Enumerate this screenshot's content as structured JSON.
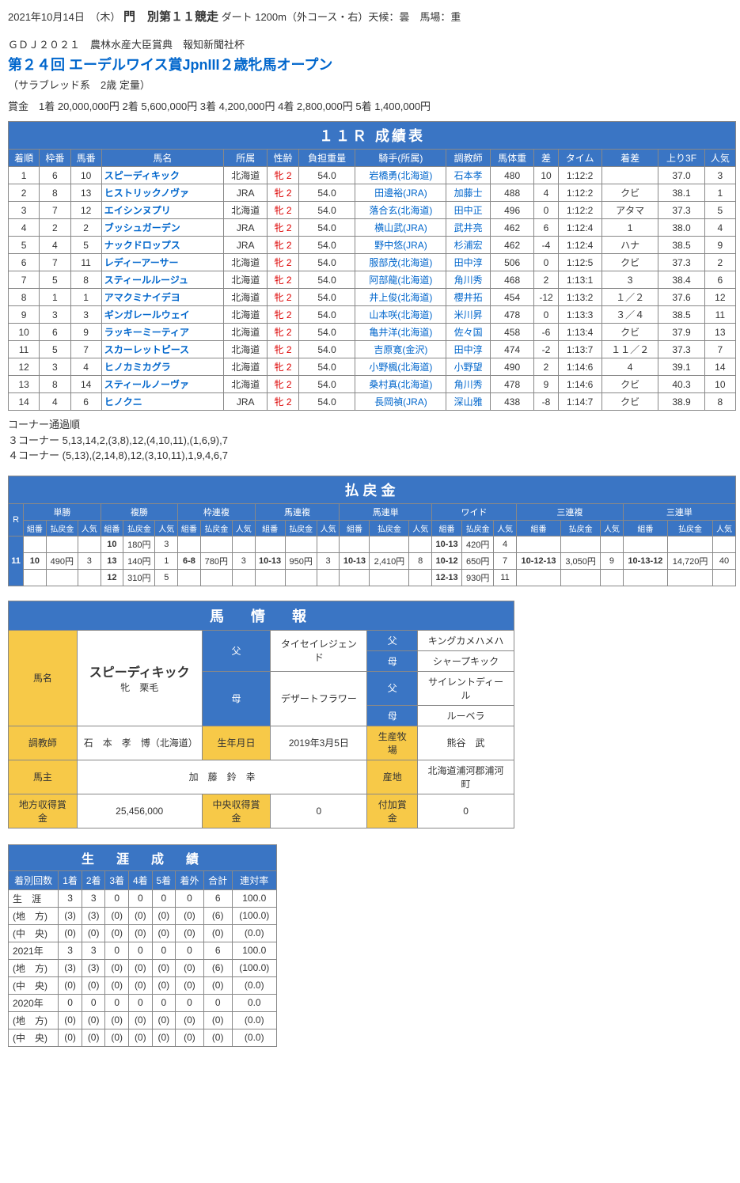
{
  "header": {
    "date": "2021年10月14日　（木）",
    "track": "門　別第１１競走",
    "course": "ダート 1200m（外コース・右）天候：曇　馬場：重",
    "gd": "ＧＤＪ２０２１　農林水産大臣賞典　報知新聞社杯",
    "title": "第２４回 エーデルワイス賞JpnIII２歳牝馬オープン",
    "sub": "（サラブレッド系　2歳 定量）",
    "prize": "賞金　1着 20,000,000円  2着 5,600,000円  3着 4,200,000円  4着 2,800,000円  5着 1,400,000円"
  },
  "result": {
    "title": "１１Ｒ 成績表",
    "cols": [
      "着順",
      "枠番",
      "馬番",
      "馬名",
      "所属",
      "性齢",
      "負担重量",
      "騎手(所属)",
      "調教師",
      "馬体重",
      "差",
      "タイム",
      "着差",
      "上り3F",
      "人気"
    ],
    "rows": [
      [
        "1",
        "6",
        "10",
        "スピーディキック",
        "北海道",
        "牝 2",
        "54.0",
        "岩橋勇(北海道)",
        "石本孝",
        "480",
        "10",
        "1:12:2",
        "",
        "37.0",
        "3"
      ],
      [
        "2",
        "8",
        "13",
        "ヒストリックノヴァ",
        "JRA",
        "牝 2",
        "54.0",
        "田邊裕(JRA)",
        "加藤士",
        "488",
        "4",
        "1:12:2",
        "クビ",
        "38.1",
        "1"
      ],
      [
        "3",
        "7",
        "12",
        "エイシンヌプリ",
        "北海道",
        "牝 2",
        "54.0",
        "落合玄(北海道)",
        "田中正",
        "496",
        "0",
        "1:12:2",
        "アタマ",
        "37.3",
        "5"
      ],
      [
        "4",
        "2",
        "2",
        "ブッシュガーデン",
        "JRA",
        "牝 2",
        "54.0",
        "横山武(JRA)",
        "武井亮",
        "462",
        "6",
        "1:12:4",
        "1",
        "38.0",
        "4"
      ],
      [
        "5",
        "4",
        "5",
        "ナックドロップス",
        "JRA",
        "牝 2",
        "54.0",
        "野中悠(JRA)",
        "杉浦宏",
        "462",
        "-4",
        "1:12:4",
        "ハナ",
        "38.5",
        "9"
      ],
      [
        "6",
        "7",
        "11",
        "レディーアーサー",
        "北海道",
        "牝 2",
        "54.0",
        "服部茂(北海道)",
        "田中淳",
        "506",
        "0",
        "1:12:5",
        "クビ",
        "37.3",
        "2"
      ],
      [
        "7",
        "5",
        "8",
        "スティールルージュ",
        "北海道",
        "牝 2",
        "54.0",
        "阿部龍(北海道)",
        "角川秀",
        "468",
        "2",
        "1:13:1",
        "3",
        "38.4",
        "6"
      ],
      [
        "8",
        "1",
        "1",
        "アマクミナイデヨ",
        "北海道",
        "牝 2",
        "54.0",
        "井上俊(北海道)",
        "櫻井拓",
        "454",
        "-12",
        "1:13:2",
        "１／２",
        "37.6",
        "12"
      ],
      [
        "9",
        "3",
        "3",
        "ギンガレールウェイ",
        "北海道",
        "牝 2",
        "54.0",
        "山本咲(北海道)",
        "米川昇",
        "478",
        "0",
        "1:13:3",
        "３／４",
        "38.5",
        "11"
      ],
      [
        "10",
        "6",
        "9",
        "ラッキーミーティア",
        "北海道",
        "牝 2",
        "54.0",
        "亀井洋(北海道)",
        "佐々国",
        "458",
        "-6",
        "1:13:4",
        "クビ",
        "37.9",
        "13"
      ],
      [
        "11",
        "5",
        "7",
        "スカーレットピース",
        "北海道",
        "牝 2",
        "54.0",
        "吉原寛(金沢)",
        "田中淳",
        "474",
        "-2",
        "1:13:7",
        "１１／２",
        "37.3",
        "7"
      ],
      [
        "12",
        "3",
        "4",
        "ヒノカミカグラ",
        "北海道",
        "牝 2",
        "54.0",
        "小野楓(北海道)",
        "小野望",
        "490",
        "2",
        "1:14:6",
        "4",
        "39.1",
        "14"
      ],
      [
        "13",
        "8",
        "14",
        "スティールノーヴァ",
        "北海道",
        "牝 2",
        "54.0",
        "桑村真(北海道)",
        "角川秀",
        "478",
        "9",
        "1:14:6",
        "クビ",
        "40.3",
        "10"
      ],
      [
        "14",
        "4",
        "6",
        "ヒノクニ",
        "JRA",
        "牝 2",
        "54.0",
        "長岡禎(JRA)",
        "深山雅",
        "438",
        "-8",
        "1:14:7",
        "クビ",
        "38.9",
        "8"
      ]
    ]
  },
  "corner": {
    "label": "コーナー通過順",
    "c3": "３コーナー 5,13,14,2,(3,8),12,(4,10,11),(1,6,9),7",
    "c4": "４コーナー (5,13),(2,14,8),12,(3,10,11),1,9,4,6,7"
  },
  "payout": {
    "title": "払戻金",
    "r": "R",
    "rnum": "11",
    "types": [
      "単勝",
      "複勝",
      "枠連複",
      "馬連複",
      "馬連単",
      "ワイド",
      "三連複",
      "三連単"
    ],
    "sub": [
      "組番",
      "払戻金",
      "人気"
    ],
    "tansho": {
      "k": "10",
      "v": "490円",
      "p": "3"
    },
    "fukusho": [
      [
        "10",
        "180円",
        "3"
      ],
      [
        "13",
        "140円",
        "1"
      ],
      [
        "12",
        "310円",
        "5"
      ]
    ],
    "wakuren": {
      "k": "6-8",
      "v": "780円",
      "p": "3"
    },
    "umaren": {
      "k": "10-13",
      "v": "950円",
      "p": "3"
    },
    "umatan": {
      "k": "10-13",
      "v": "2,410円",
      "p": "8"
    },
    "wide": [
      [
        "10-13",
        "420円",
        "4"
      ],
      [
        "10-12",
        "650円",
        "7"
      ],
      [
        "12-13",
        "930円",
        "11"
      ]
    ],
    "sanrenpuku": {
      "k": "10-12-13",
      "v": "3,050円",
      "p": "9"
    },
    "sanrentan": {
      "k": "10-13-12",
      "v": "14,720円",
      "p": "40"
    }
  },
  "info": {
    "title": "馬　情　報",
    "labels": {
      "name": "馬名",
      "sire": "父",
      "dam": "母",
      "trainer": "調教師",
      "birth": "生年月日",
      "farm": "生産牧場",
      "owner": "馬主",
      "origin": "産地",
      "local": "地方収得賞金",
      "central": "中央収得賞金",
      "bonus": "付加賞金"
    },
    "horseName": "スピーディキック",
    "sexColor": "牝　栗毛",
    "sire": "タイセイレジェンド",
    "sireSire": "キングカメハメハ",
    "sireDam": "シャープキック",
    "dam": "デザートフラワー",
    "damSire": "サイレントディール",
    "damDam": "ルーベラ",
    "trainer": "石　本　孝　博（北海道）",
    "birth": "2019年3月5日",
    "farm": "熊谷　武",
    "owner": "加　藤　鈴　幸",
    "origin": "北海道浦河郡浦河町",
    "local": "25,456,000",
    "central": "0",
    "bonus": "0"
  },
  "career": {
    "title": "生　涯　成　績",
    "cols": [
      "着別回数",
      "1着",
      "2着",
      "3着",
      "4着",
      "5着",
      "着外",
      "合計",
      "連対率"
    ],
    "rows": [
      [
        "生　涯",
        "3",
        "3",
        "0",
        "0",
        "0",
        "0",
        "6",
        "100.0"
      ],
      [
        "(地　方)",
        "(3)",
        "(3)",
        "(0)",
        "(0)",
        "(0)",
        "(0)",
        "(6)",
        "(100.0)"
      ],
      [
        "(中　央)",
        "(0)",
        "(0)",
        "(0)",
        "(0)",
        "(0)",
        "(0)",
        "(0)",
        "(0.0)"
      ],
      [
        "2021年",
        "3",
        "3",
        "0",
        "0",
        "0",
        "0",
        "6",
        "100.0"
      ],
      [
        "(地　方)",
        "(3)",
        "(3)",
        "(0)",
        "(0)",
        "(0)",
        "(0)",
        "(6)",
        "(100.0)"
      ],
      [
        "(中　央)",
        "(0)",
        "(0)",
        "(0)",
        "(0)",
        "(0)",
        "(0)",
        "(0)",
        "(0.0)"
      ],
      [
        "2020年",
        "0",
        "0",
        "0",
        "0",
        "0",
        "0",
        "0",
        "0.0"
      ],
      [
        "(地　方)",
        "(0)",
        "(0)",
        "(0)",
        "(0)",
        "(0)",
        "(0)",
        "(0)",
        "(0.0)"
      ],
      [
        "(中　央)",
        "(0)",
        "(0)",
        "(0)",
        "(0)",
        "(0)",
        "(0)",
        "(0)",
        "(0.0)"
      ]
    ]
  }
}
